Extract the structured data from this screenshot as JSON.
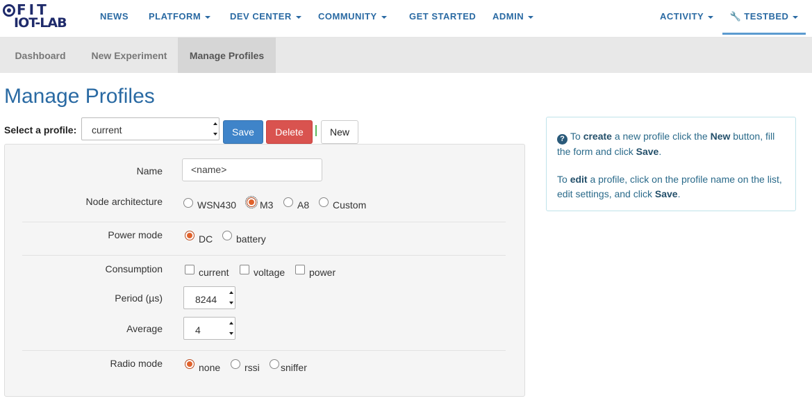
{
  "logo": {
    "line1": "FIT",
    "line2": "IOT-LAB"
  },
  "nav": {
    "news": "NEWS",
    "platform": "PLATFORM",
    "dev_center": "DEV CENTER",
    "community": "COMMUNITY",
    "get_started": "GET STARTED",
    "admin": "ADMIN",
    "activity": "ACTIVITY",
    "testbed": "TESTBED"
  },
  "subnav": {
    "tabs": [
      {
        "label": "Dashboard"
      },
      {
        "label": "New Experiment"
      },
      {
        "label": "Manage Profiles"
      }
    ],
    "active": "Manage Profiles"
  },
  "page": {
    "title": "Manage Profiles"
  },
  "profile_select": {
    "label": "Select a profile:",
    "value": "current"
  },
  "buttons": {
    "save": "Save",
    "delete": "Delete",
    "new": "New"
  },
  "form": {
    "name": {
      "label": "Name",
      "value": "<name>"
    },
    "node_architecture": {
      "label": "Node architecture",
      "options": [
        "WSN430",
        "M3",
        "A8",
        "Custom"
      ],
      "selected": "M3"
    },
    "power_mode": {
      "label": "Power mode",
      "options": [
        "DC",
        "battery"
      ],
      "selected": "DC"
    },
    "consumption": {
      "label": "Consumption",
      "options": [
        "current",
        "voltage",
        "power"
      ],
      "checked": []
    },
    "period": {
      "label": "Period (µs)",
      "value": "8244"
    },
    "average": {
      "label": "Average",
      "value": "4"
    },
    "radio_mode": {
      "label": "Radio mode",
      "options": [
        "none",
        "rssi",
        "sniffer"
      ],
      "selected": "none"
    }
  },
  "info": {
    "p1_a": "To ",
    "p1_b": "create",
    "p1_c": " a new profile click the ",
    "p1_d": "New",
    "p1_e": " button, fill the form and click ",
    "p1_f": "Save",
    "p1_g": ".",
    "p2_a": "To ",
    "p2_b": "edit",
    "p2_c": " a profile, click on the profile name on the list, edit settings, and click ",
    "p2_d": "Save",
    "p2_e": "."
  },
  "colors": {
    "brand": "#2a6aa3",
    "save": "#3f84c9",
    "delete": "#d9534f",
    "radio_selected": "#e0622c",
    "info_border": "#bfe3ea"
  }
}
